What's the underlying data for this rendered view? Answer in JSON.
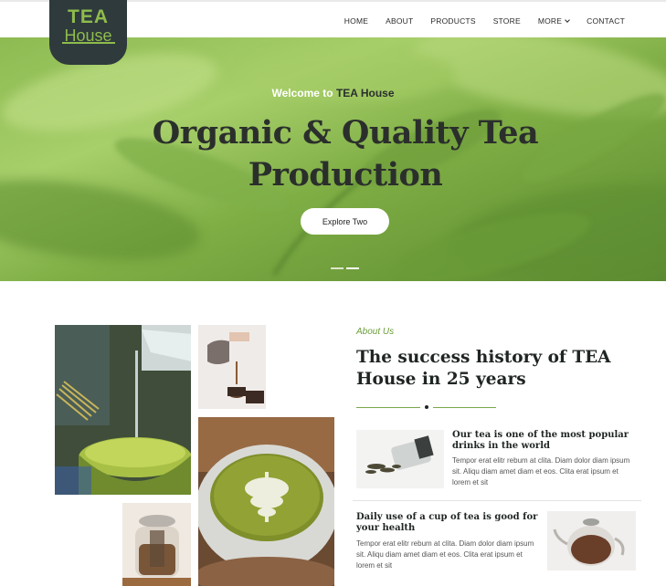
{
  "nav": {
    "logo_main": "TEA",
    "logo_sub": "House",
    "items": [
      {
        "label": "HOME"
      },
      {
        "label": "ABOUT"
      },
      {
        "label": "PRODUCTS"
      },
      {
        "label": "STORE"
      },
      {
        "label": "MORE"
      },
      {
        "label": "CONTACT"
      }
    ]
  },
  "hero": {
    "welcome_prefix": "Welcome to",
    "welcome_brand": "TEA House",
    "title_line1": "Organic & Quality Tea",
    "title_line2": "Production",
    "button_label": "Explore Two"
  },
  "about": {
    "label": "About Us",
    "title_line1": "The success history of TEA",
    "title_line2": "House in 25 years",
    "features": [
      {
        "title": "Our tea is one of the most popular drinks in the world",
        "text": "Tempor erat elitr rebum at clita. Diam dolor diam ipsum sit. Aliqu diam amet diam et eos. Clita erat ipsum et lorem et sit"
      },
      {
        "title": "Daily use of a cup of tea is good for your health",
        "text": "Tempor erat elitr rebum at clita. Diam dolor diam ipsum sit. Aliqu diam amet diam et eos. Clita erat ipsum et lorem et sit"
      }
    ]
  },
  "colors": {
    "accent": "#6a9e3c",
    "logo_bg": "#2f3a3d",
    "logo_text": "#8ebc4b",
    "dark_text": "#1f2523"
  }
}
